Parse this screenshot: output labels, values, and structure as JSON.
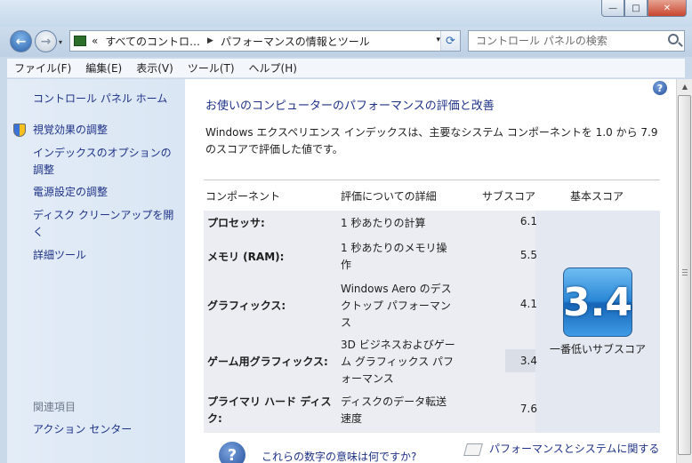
{
  "window": {
    "buttons": {
      "minimize": "—",
      "maximize": "□",
      "close": "✕"
    }
  },
  "nav": {
    "back_icon": "back-arrow-icon",
    "forward_icon": "forward-arrow-icon",
    "address": {
      "prefix": "«",
      "segments": [
        "すべてのコントロ…",
        "パフォーマンスの情報とツール"
      ],
      "separator": "▶"
    },
    "search": {
      "placeholder": "コントロール パネルの検索"
    }
  },
  "menubar": [
    "ファイル(F)",
    "編集(E)",
    "表示(V)",
    "ツール(T)",
    "ヘルプ(H)"
  ],
  "sidebar": {
    "home": "コントロール パネル ホーム",
    "links": [
      "視覚効果の調整",
      "インデックスのオプションの調整",
      "電源設定の調整",
      "ディスク クリーンアップを開く",
      "詳細ツール"
    ],
    "related_heading": "関連項目",
    "related_links": [
      "アクション センター"
    ]
  },
  "main": {
    "help": "?",
    "title": "お使いのコンピューターのパフォーマンスの評価と改善",
    "description": "Windows エクスペリエンス インデックスは、主要なシステム コンポーネントを 1.0 から 7.9 のスコアで評価した値です。",
    "table": {
      "headers": [
        "コンポーネント",
        "評価についての詳細",
        "サブスコア",
        "基本スコア"
      ],
      "rows": [
        {
          "component": "プロセッサ:",
          "detail": "1 秒あたりの計算",
          "subscore": "6.1"
        },
        {
          "component": "メモリ (RAM):",
          "detail": "1 秒あたりのメモリ操作",
          "subscore": "5.5"
        },
        {
          "component": "グラフィックス:",
          "detail": "Windows Aero のデスクトップ パフォーマンス",
          "subscore": "4.1"
        },
        {
          "component": "ゲーム用グラフィックス:",
          "detail": "3D ビジネスおよびゲーム グラフィックス パフォーマンス",
          "subscore": "3.4"
        },
        {
          "component": "プライマリ ハード ディスク:",
          "detail": "ディスクのデータ転送速度",
          "subscore": "7.6"
        }
      ],
      "base_score": "3.4",
      "base_caption": "一番低いサブスコア"
    },
    "footer_links": [
      "これらの数字の意味は何ですか?",
      "パフォーマンスとシステムに関する"
    ]
  }
}
